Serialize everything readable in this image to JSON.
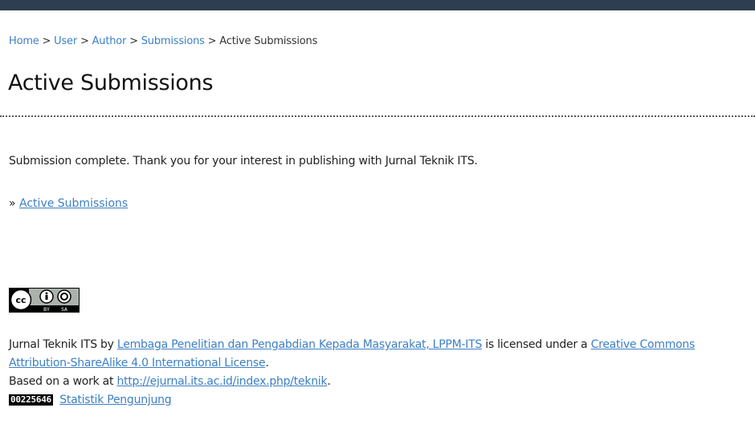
{
  "breadcrumb": {
    "items": [
      {
        "label": "Home"
      },
      {
        "label": "User"
      },
      {
        "label": "Author"
      },
      {
        "label": "Submissions"
      }
    ],
    "current": "Active Submissions",
    "separator": ">"
  },
  "page": {
    "title": "Active Submissions",
    "message": "Submission complete. Thank you for your interest in publishing with Jurnal Teknik ITS.",
    "nav_prefix": "»",
    "nav_link": "Active Submissions"
  },
  "license_badge": {
    "icon": "cc-by-sa-icon",
    "texts": [
      "BY",
      "SA"
    ]
  },
  "footer": {
    "work": "Jurnal Teknik ITS",
    "by": "by",
    "author_link": "Lembaga Penelitian dan Pengabdian Kepada Masyarakat, LPPM-ITS",
    "licensed": "is licensed under a",
    "license_link": "Creative Commons Attribution-ShareAlike 4.0 International License",
    "period": ".",
    "based_prefix": "Based on a work at",
    "based_link": "http://ejurnal.its.ac.id/index.php/teknik",
    "counter": "00225646",
    "stat_link": "Statistik Pengunjung"
  },
  "colors": {
    "link": "#3c7fc4",
    "topbar": "#2c3e50"
  }
}
